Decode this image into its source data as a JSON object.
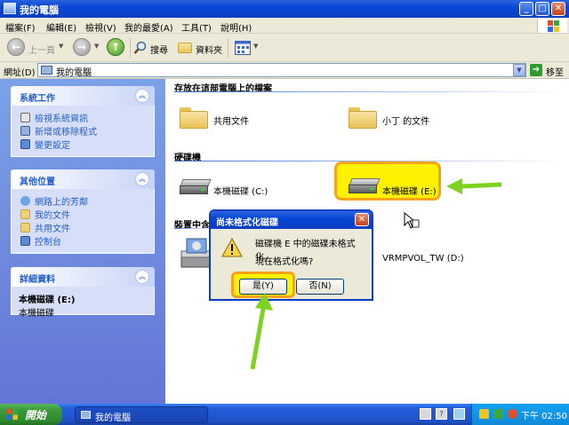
{
  "window": {
    "title": "我的電腦",
    "min_glyph": "_",
    "max_glyph": "□",
    "close_glyph": "✕"
  },
  "menu": {
    "items": [
      "檔案(F)",
      "編輯(E)",
      "檢視(V)",
      "我的最愛(A)",
      "工具(T)",
      "說明(H)"
    ]
  },
  "toolbar": {
    "back_label": "上一頁",
    "back_glyph": "←",
    "forward_glyph": "→",
    "up_glyph": "↑",
    "search_label": "搜尋",
    "folders_label": "資料夾",
    "dropdown_glyph": "▼"
  },
  "address": {
    "label": "網址(D)",
    "value": "我的電腦",
    "go_label": "移至",
    "go_glyph": "➔",
    "dropdown_glyph": "▼"
  },
  "sidebar": {
    "collapse_glyph": "︽",
    "system_tasks": {
      "title": "系統工作",
      "items": [
        "檢視系統資訊",
        "新增或移除程式",
        "變更設定"
      ]
    },
    "other_places": {
      "title": "其他位置",
      "items": [
        "網路上的芳鄰",
        "我的文件",
        "共用文件",
        "控制台"
      ]
    },
    "details": {
      "title": "詳細資料",
      "name": "本機磁碟 (E:)",
      "type": "本機磁碟"
    }
  },
  "content": {
    "sections": {
      "files": "存放在這部電腦上的檔案",
      "hard_drives": "硬碟機",
      "removable": "裝置中含"
    },
    "files": [
      "共用文件",
      "小丁 的文件"
    ],
    "drives": [
      "本機磁碟 (C:)",
      "本機磁碟 (E:)"
    ],
    "removable": {
      "label": "VRMPVOL_TW (D:)"
    }
  },
  "dialog": {
    "title": "尚未格式化磁碟",
    "close_glyph": "✕",
    "message_line1": "磁碟機 E 中的磁碟未格式化。",
    "message_line2": "現在格式化嗎?",
    "yes_label": "是(Y)",
    "no_label": "否(N)"
  },
  "taskbar": {
    "start_label": "開始",
    "task_label": "我的電腦",
    "clock": "下午 02:50",
    "quick_glyph": "?"
  },
  "colors": {
    "xp_blue": "#0a3fc0",
    "highlight_yellow": "#fff200",
    "highlight_border": "#f6a31c",
    "arrow_green": "#7ed321",
    "sidebar_link": "#215dc6"
  }
}
